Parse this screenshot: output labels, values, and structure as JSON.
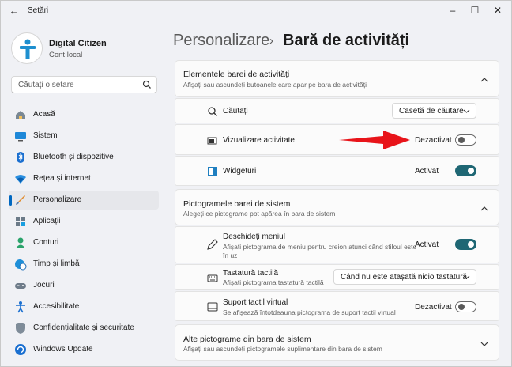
{
  "window": {
    "title": "Setări"
  },
  "profile": {
    "name": "Digital Citizen",
    "account": "Cont local"
  },
  "search": {
    "placeholder": "Căutați o setare"
  },
  "nav": {
    "items": [
      {
        "label": "Acasă",
        "icon": "home-icon"
      },
      {
        "label": "Sistem",
        "icon": "system-icon"
      },
      {
        "label": "Bluetooth și dispozitive",
        "icon": "bluetooth-icon"
      },
      {
        "label": "Rețea și internet",
        "icon": "wifi-icon"
      },
      {
        "label": "Personalizare",
        "icon": "brush-icon",
        "active": true
      },
      {
        "label": "Aplicații",
        "icon": "apps-icon"
      },
      {
        "label": "Conturi",
        "icon": "account-icon"
      },
      {
        "label": "Timp și limbă",
        "icon": "globe-clock-icon"
      },
      {
        "label": "Jocuri",
        "icon": "gamepad-icon"
      },
      {
        "label": "Accesibilitate",
        "icon": "accessibility-icon"
      },
      {
        "label": "Confidențialitate și securitate",
        "icon": "shield-icon"
      },
      {
        "label": "Windows Update",
        "icon": "update-icon"
      }
    ]
  },
  "breadcrumb": {
    "parent": "Personalizare",
    "separator": "›",
    "current": "Bară de activități"
  },
  "sections": {
    "taskbar_items": {
      "title": "Elementele barei de activități",
      "subtitle": "Afișați sau ascundeți butoanele care apar pe bara de activități",
      "rows": [
        {
          "label": "Căutați",
          "icon": "search-icon",
          "control": "dropdown",
          "value": "Casetă de căutare"
        },
        {
          "label": "Vizualizare activitate",
          "icon": "task-view-icon",
          "control": "toggle",
          "state": "Dezactivat",
          "on": false
        },
        {
          "label": "Widgeturi",
          "icon": "widgets-icon",
          "control": "toggle",
          "state": "Activat",
          "on": true
        }
      ]
    },
    "system_tray": {
      "title": "Pictogramele barei de sistem",
      "subtitle": "Alegeți ce pictograme pot apărea în bara de sistem",
      "rows": [
        {
          "label": "Deschideți meniul",
          "sub": "Afișați pictograma de meniu pentru creion atunci când stiloul este în uz",
          "icon": "pen-icon",
          "control": "toggle",
          "state": "Activat",
          "on": true
        },
        {
          "label": "Tastatură tactilă",
          "sub": "Afișați pictograma tastatură tactilă",
          "icon": "keyboard-icon",
          "control": "dropdown",
          "value": "Când nu este atașată nicio tastatură"
        },
        {
          "label": "Suport tactil virtual",
          "sub": "Se afișează întotdeauna pictograma de suport tactil virtual",
          "icon": "touchpad-icon",
          "control": "toggle",
          "state": "Dezactivat",
          "on": false
        }
      ]
    },
    "other_tray": {
      "title": "Alte pictograme din bara de sistem",
      "subtitle": "Afișați sau ascundeți pictogramele suplimentare din bara de sistem"
    }
  },
  "colors": {
    "accent": "#0067c0",
    "toggle_on": "#1f6774",
    "annotation_arrow": "#e8141a"
  }
}
